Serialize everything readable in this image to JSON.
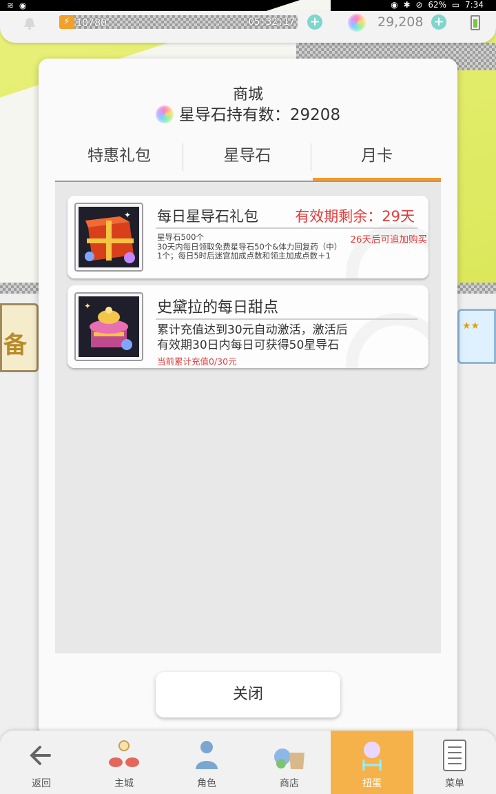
{
  "status_bar": {
    "battery_pct": "62%",
    "time": "7:34"
  },
  "hud": {
    "stamina": "10/80",
    "timer": "05:32:17",
    "gems": "29,208"
  },
  "shop": {
    "title": "商城",
    "gem_holding": "星导石持有数：29208",
    "tabs": [
      {
        "label": "特惠礼包",
        "active": false
      },
      {
        "label": "星导石",
        "active": false
      },
      {
        "label": "月卡",
        "active": true
      }
    ],
    "cards": [
      {
        "name": "每日星导石礼包",
        "validity": "有效期剩余：29天",
        "rebuy_note": "26天后可追加购买",
        "desc_lines": [
          "星导石500个",
          "30天内每日领取免费星导石50个&体力回复药（中）",
          "1个；每日5时后迷宫加成点数和领主加成点数＋1"
        ]
      },
      {
        "name": "史黛拉的每日甜点",
        "desc_lines": [
          "累计充值达到30元自动激活，激活后",
          "有效期30日内每日可获得50星导石"
        ],
        "progress": "当前累计充值0/30元"
      }
    ],
    "close_label": "关闭"
  },
  "side_banner_left": "备",
  "nav": [
    {
      "label": "返回",
      "icon": "back-arrow-icon",
      "active": false
    },
    {
      "label": "主城",
      "icon": "castle-icon",
      "active": false
    },
    {
      "label": "角色",
      "icon": "character-icon",
      "active": false
    },
    {
      "label": "商店",
      "icon": "shop-bag-icon",
      "active": false
    },
    {
      "label": "扭蛋",
      "icon": "gacha-icon",
      "active": true
    },
    {
      "label": "菜单",
      "icon": "menu-list-icon",
      "active": false
    }
  ],
  "colors": {
    "accent": "#f59a23",
    "alert": "#e23b3b",
    "nav_active": "#f6b24a"
  }
}
